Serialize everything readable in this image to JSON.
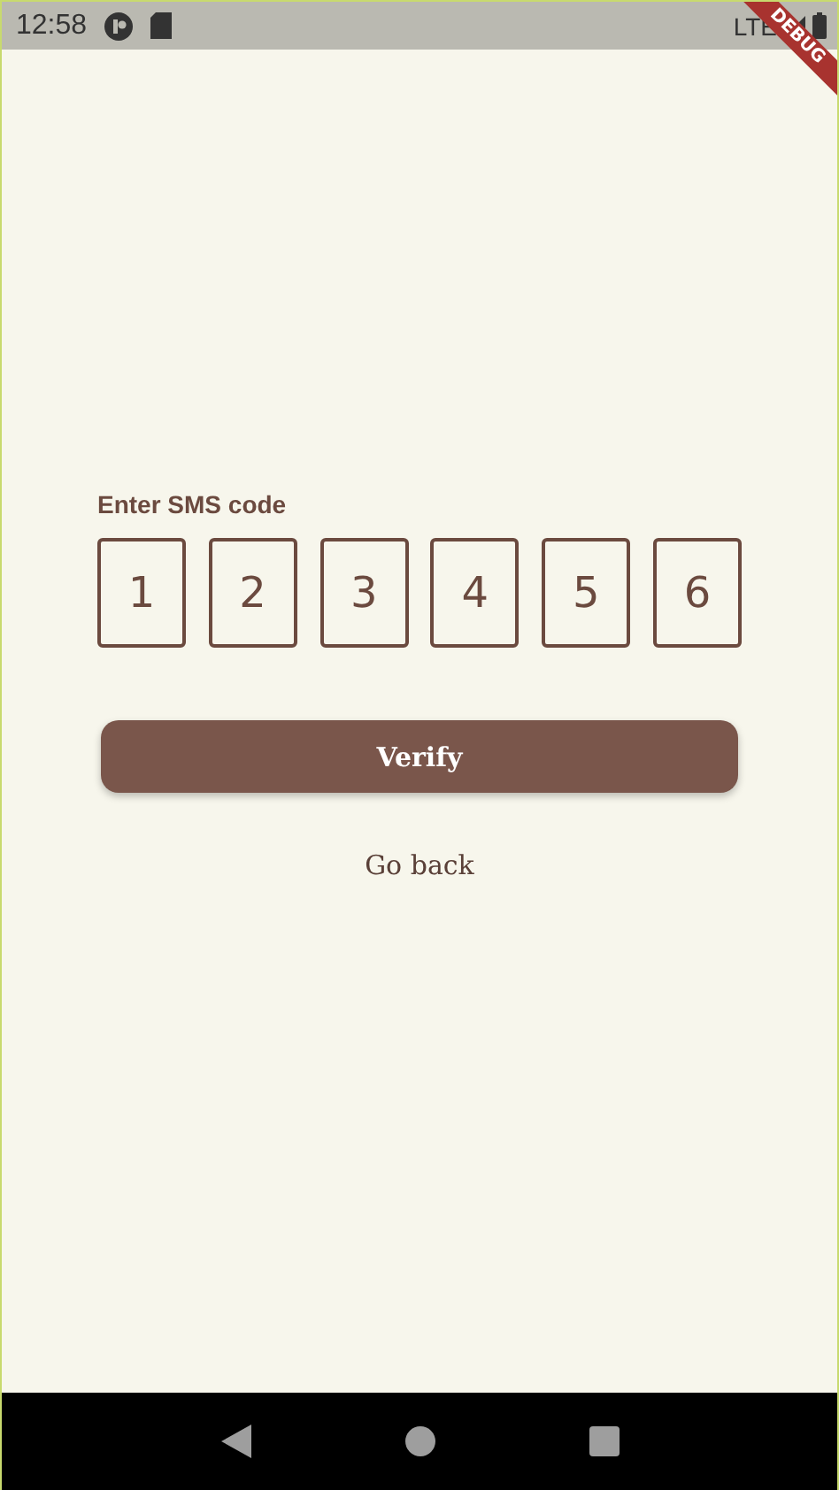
{
  "status_bar": {
    "time": "12:58",
    "network": "LTE"
  },
  "debug_banner": {
    "label": "DEBUG"
  },
  "sms_form": {
    "label": "Enter SMS code",
    "digits": [
      "1",
      "2",
      "3",
      "4",
      "5",
      "6"
    ],
    "verify_button": "Verify",
    "back_link": "Go back"
  }
}
